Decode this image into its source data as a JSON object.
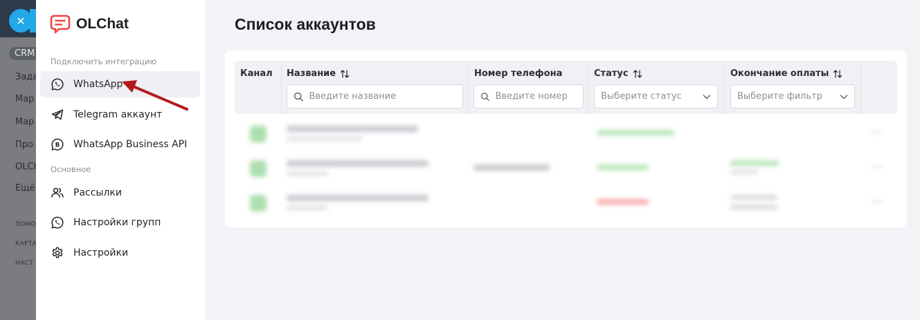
{
  "crm_background": {
    "close_symbol": "✕",
    "items": [
      "CRM",
      "Зада",
      "Мар",
      "Мар",
      "Про",
      "OLCh",
      "Ещё"
    ],
    "footer_items": [
      "ПОМО",
      "КАРТА",
      "НАСТ"
    ]
  },
  "logo": {
    "text": "OLChat",
    "brand_color": "#ef4444"
  },
  "sidebar": {
    "section_integration": "Подключить интеграцию",
    "integration_items": [
      {
        "label": "WhatsApp",
        "icon": "whatsapp-icon",
        "active": true
      },
      {
        "label": "Telegram аккаунт",
        "icon": "telegram-icon"
      },
      {
        "label": "WhatsApp Business API",
        "icon": "whatsapp-business-icon"
      }
    ],
    "section_main": "Основное",
    "main_items": [
      {
        "label": "Рассылки",
        "icon": "users-icon"
      },
      {
        "label": "Настройки групп",
        "icon": "whatsapp-icon"
      },
      {
        "label": "Настройки",
        "icon": "gear-icon"
      }
    ]
  },
  "main": {
    "title": "Список аккаунтов",
    "table": {
      "columns": {
        "channel": "Канал",
        "name": "Название",
        "phone": "Номер телефона",
        "status": "Статус",
        "payment_end": "Окончание оплаты"
      },
      "filters": {
        "name_placeholder": "Введите название",
        "phone_placeholder": "Введите номер",
        "status_placeholder": "Выберите статус",
        "payment_placeholder": "Выберите фильтр"
      }
    }
  },
  "colors": {
    "accent_arrow": "#b3191e",
    "active_item_bg": "#eff0f3",
    "status_green": "#4caf50",
    "status_red": "#e53935"
  }
}
